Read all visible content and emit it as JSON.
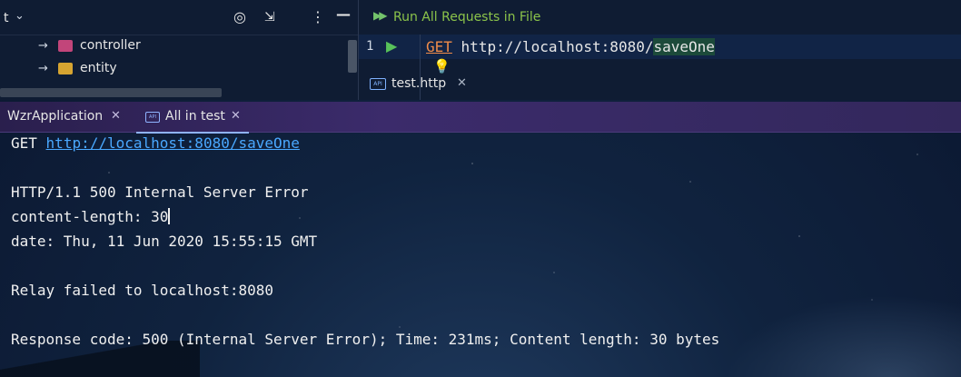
{
  "project": {
    "title_fragment": "t",
    "tree": [
      {
        "label": "controller",
        "folder_color": "#c2457a"
      },
      {
        "label": "entity",
        "folder_color": "#d6a431"
      }
    ]
  },
  "editor": {
    "run_all_label": "Run All Requests in File",
    "line_number": "1",
    "method": "GET",
    "url_prefix": "http://localhost:8080/",
    "url_highlight": "saveOne",
    "tab": {
      "badge": "API",
      "label": "test.http"
    }
  },
  "tool_tabs": [
    {
      "label": "WzrApplication",
      "active": false
    },
    {
      "label": "All in test",
      "active": true
    }
  ],
  "console": {
    "request_method": "GET",
    "request_url": "http://localhost:8080/saveOne",
    "status_line": "HTTP/1.1 500 Internal Server Error",
    "header_content_length": "content-length: 30",
    "header_date": "date: Thu, 11 Jun 2020 15:55:15 GMT",
    "relay_message": "Relay failed to localhost:8080",
    "summary": "Response code: 500 (Internal Server Error); Time: 231ms; Content length: 30 bytes"
  },
  "colors": {
    "accent_link": "#4aa8ff",
    "run_green": "#73c36b",
    "method_orange": "#f08c49"
  },
  "icons": [
    "target-icon",
    "collapse-icon",
    "more-vert-icon",
    "minimize-icon",
    "run-icon",
    "lightbulb-icon",
    "close-icon"
  ]
}
